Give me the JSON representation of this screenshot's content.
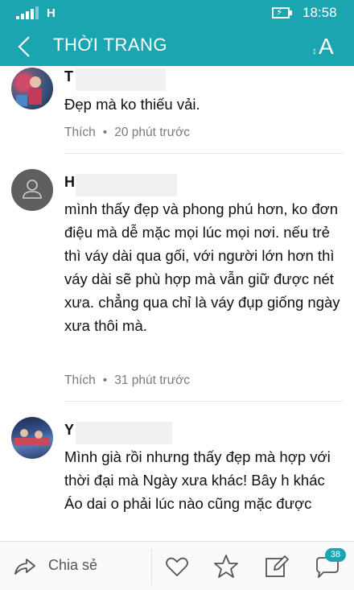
{
  "status_bar": {
    "network": "H",
    "time": "18:58"
  },
  "header": {
    "title": "THỜI TRANG"
  },
  "comments": [
    {
      "initial": "T",
      "text": "Đẹp mà ko thiếu vải.",
      "like_label": "Thích",
      "time": "20 phút trước"
    },
    {
      "initial": "H",
      "text": "mình thấy đẹp và phong phú hơn, ko đơn điệu mà dễ mặc mọi lúc mọi nơi. nếu trẻ thì váy dài qua gối, với người lớn hơn thì váy dài sẽ phù hợp mà vẫn giữ được nét xưa. chẳng qua chỉ là váy đụp giống ngày xưa thôi mà.",
      "like_label": "Thích",
      "time": "31 phút trước"
    },
    {
      "initial": "Y",
      "text": "Mình già rồi nhưng thấy đẹp mà hợp với thời đại mà Ngày xưa khác! Bây h khác Áo dai o phải lúc nào cũng mặc được",
      "like_label": "",
      "time": ""
    }
  ],
  "bottom_bar": {
    "share_label": "Chia sẻ",
    "comment_count": "38"
  },
  "colors": {
    "accent": "#1aa5b0",
    "meta_text": "#7b7b7b"
  }
}
